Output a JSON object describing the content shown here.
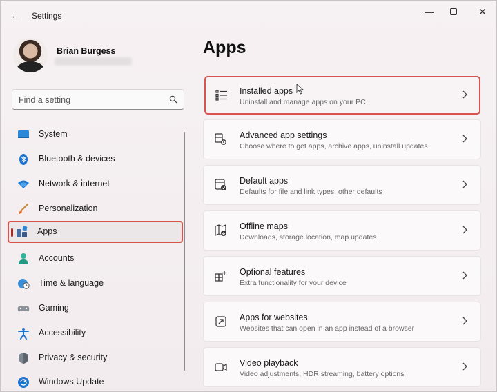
{
  "window": {
    "title": "Settings"
  },
  "profile": {
    "name": "Brian Burgess"
  },
  "search": {
    "placeholder": "Find a setting"
  },
  "sidebar": {
    "items": [
      {
        "label": "System",
        "icon": "monitor-icon"
      },
      {
        "label": "Bluetooth & devices",
        "icon": "bluetooth-icon"
      },
      {
        "label": "Network & internet",
        "icon": "wifi-icon"
      },
      {
        "label": "Personalization",
        "icon": "brush-icon"
      },
      {
        "label": "Apps",
        "icon": "apps-icon",
        "active": true
      },
      {
        "label": "Accounts",
        "icon": "person-icon"
      },
      {
        "label": "Time & language",
        "icon": "globe-clock-icon"
      },
      {
        "label": "Gaming",
        "icon": "gamepad-icon"
      },
      {
        "label": "Accessibility",
        "icon": "accessibility-icon"
      },
      {
        "label": "Privacy & security",
        "icon": "shield-icon"
      },
      {
        "label": "Windows Update",
        "icon": "update-icon"
      }
    ]
  },
  "main": {
    "title": "Apps",
    "cards": [
      {
        "title": "Installed apps",
        "subtitle": "Uninstall and manage apps on your PC",
        "icon": "list-icon"
      },
      {
        "title": "Advanced app settings",
        "subtitle": "Choose where to get apps, archive apps, uninstall updates",
        "icon": "app-settings-icon"
      },
      {
        "title": "Default apps",
        "subtitle": "Defaults for file and link types, other defaults",
        "icon": "default-apps-icon"
      },
      {
        "title": "Offline maps",
        "subtitle": "Downloads, storage location, map updates",
        "icon": "map-icon"
      },
      {
        "title": "Optional features",
        "subtitle": "Extra functionality for your device",
        "icon": "optional-features-icon"
      },
      {
        "title": "Apps for websites",
        "subtitle": "Websites that can open in an app instead of a browser",
        "icon": "web-app-icon"
      },
      {
        "title": "Video playback",
        "subtitle": "Video adjustments, HDR streaming, battery options",
        "icon": "video-icon"
      }
    ]
  },
  "colors": {
    "highlight": "#d9534f",
    "accent": "#0067c0"
  }
}
